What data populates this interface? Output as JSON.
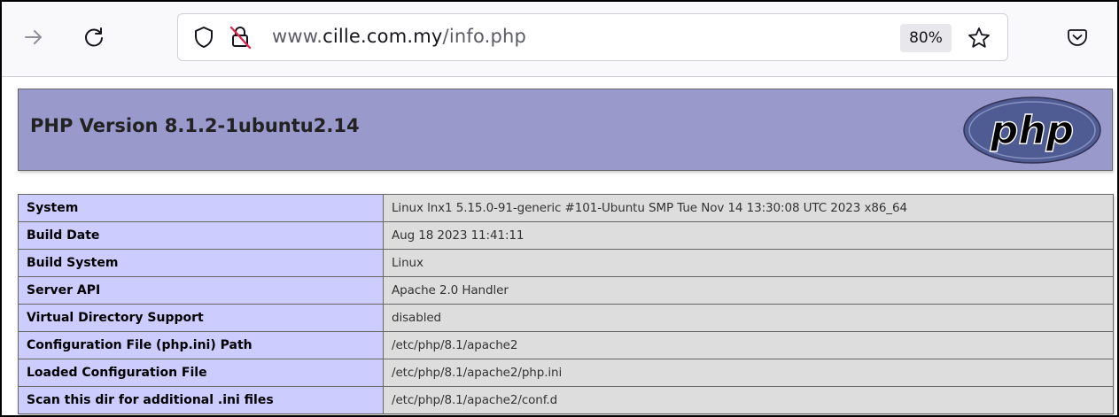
{
  "browser": {
    "url_prefix": "www.",
    "url_domain": "cille.com.my",
    "url_path": "/info.php",
    "zoom": "80%",
    "icons": [
      "forward-arrow-icon",
      "reload-icon",
      "shield-icon",
      "insecure-lock-icon",
      "bookmark-star-icon",
      "pocket-icon"
    ]
  },
  "page": {
    "title": "PHP Version 8.1.2-1ubuntu2.14",
    "logo_text": "php",
    "rows": [
      {
        "label": "System",
        "value": "Linux lnx1 5.15.0-91-generic #101-Ubuntu SMP Tue Nov 14 13:30:08 UTC 2023 x86_64"
      },
      {
        "label": "Build Date",
        "value": "Aug 18 2023 11:41:11"
      },
      {
        "label": "Build System",
        "value": "Linux"
      },
      {
        "label": "Server API",
        "value": "Apache 2.0 Handler"
      },
      {
        "label": "Virtual Directory Support",
        "value": "disabled"
      },
      {
        "label": "Configuration File (php.ini) Path",
        "value": "/etc/php/8.1/apache2"
      },
      {
        "label": "Loaded Configuration File",
        "value": "/etc/php/8.1/apache2/php.ini"
      },
      {
        "label": "Scan this dir for additional .ini files",
        "value": "/etc/php/8.1/apache2/conf.d"
      }
    ]
  },
  "colors": {
    "header_bg": "#9999cc",
    "label_bg": "#ccccff",
    "value_bg": "#dddddd",
    "logo_fill": "#4f5b93"
  }
}
